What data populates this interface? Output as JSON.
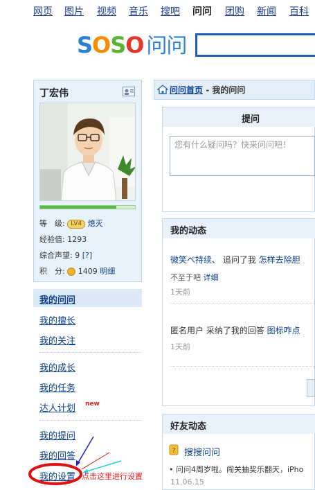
{
  "topnav": {
    "items": [
      {
        "label": "网页"
      },
      {
        "label": "图片"
      },
      {
        "label": "视频"
      },
      {
        "label": "音乐"
      },
      {
        "label": "搜吧"
      },
      {
        "label": "问问"
      },
      {
        "label": "团购"
      },
      {
        "label": "新闻"
      },
      {
        "label": "百科"
      }
    ],
    "current": "问问"
  },
  "logo": {
    "s1": "S",
    "o1": "O",
    "s2": "S",
    "o2": "O",
    "suffix": "问问"
  },
  "user": {
    "name": "丁宏伟",
    "level_label": "等　级:",
    "level_badge": "LV4",
    "level_title": "熄灭",
    "exp_label": "经验值:",
    "exp_value": "1293",
    "reputation_label": "综合声望:",
    "reputation_value": "9",
    "reputation_help": "[?]",
    "points_label": "积　分:",
    "points_value": "1409",
    "points_detail": "明细",
    "progress": 0.8
  },
  "menu": {
    "header": "我的问问",
    "group1": [
      "我的擅长",
      "我的关注"
    ],
    "group2": [
      "我的成长",
      "我的任务",
      "达人计划"
    ],
    "new_tag": "new",
    "group3": [
      "我的提问",
      "我的回答",
      "我的设置"
    ],
    "hint": "点击这里进行设置"
  },
  "breadcrumb": {
    "home": "问问首页",
    "sep": " - ",
    "current": "我的问问"
  },
  "ask": {
    "title": "提问",
    "placeholder": "您有什么疑问吗？快来问问吧！"
  },
  "dynamics": {
    "title": "我的动态",
    "item1": {
      "user": "微笑べ持续、",
      "action": " 追问了我 ",
      "link": "怎样去除胆",
      "sub": "不至于吧",
      "sub_link": "详细",
      "time": "1天前"
    },
    "item2": {
      "text": "匿名用户 采纳了我的回答 ",
      "link": "图标咋点",
      "time": "1天前"
    }
  },
  "friends": {
    "title": "好友动态",
    "link": "搜搜问问",
    "text": "• 问问4周岁啦。闯关抽奖乐翻天，iPho",
    "time": "11.06.15"
  }
}
